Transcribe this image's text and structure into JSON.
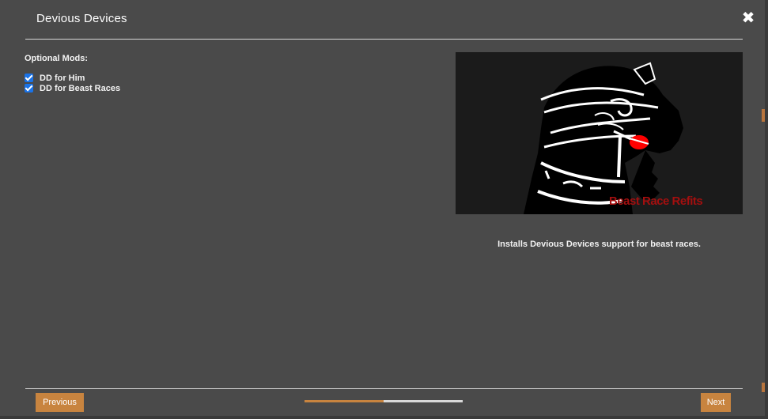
{
  "window": {
    "title": "Devious Devices",
    "close_glyph": "✖"
  },
  "options": {
    "group_label": "Optional Mods:",
    "items": [
      {
        "label": "DD for Him",
        "checked": true
      },
      {
        "label": "DD for Beast Races",
        "checked": true
      }
    ]
  },
  "preview": {
    "image_text": "Beast Race Refits",
    "description": "Installs Devious Devices support for beast races."
  },
  "footer": {
    "previous_label": "Previous",
    "next_label": "Next",
    "progress_fraction": 0.5
  },
  "colors": {
    "accent": "#c8843f",
    "checkbox": "#1a73e8",
    "image_text": "#a30f0f",
    "tongue": "#ff0000"
  }
}
